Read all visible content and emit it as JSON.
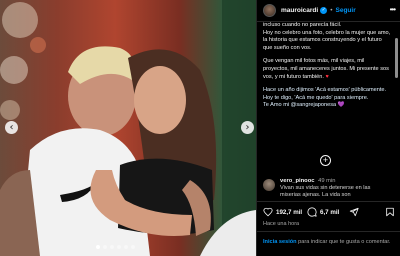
{
  "post": {
    "username": "mauroicardi",
    "follow_label": "Seguir",
    "more_icon": "more-icon",
    "separator": "•",
    "caption": [
      "incluso cuando no parecía fácil.\nHoy no celebro una foto, celebro la mujer que amo, la historia que estamos construyendo y el futuro que sueño con vos.",
      "Que vengan mil fotos más, mil viajes, mil proyectos, mil amaneceres juntos. Mi presente sos vos, y mi futuro también.",
      "Hace un año dijimos 'Acá estamos' públicamente.\nHoy te digo, 'Acá me quedo' para siempre.\nTe Amo mi @sangrejaponesa"
    ],
    "caption_emoji_1": "♥",
    "caption_emoji_2": "💜",
    "add_comment_icon": "+",
    "comment": {
      "user": "vero_pinooc",
      "time": "49 min",
      "text": "Vivan sus vidas sin detenerse en las miserias ajenas. La vida son"
    },
    "likes": "192,7 mil",
    "comments": "6,7 mil",
    "timestamp": "Hace una hora",
    "login_link": "Inicia sesión",
    "login_text": " para indicar que te gusta o comentar."
  },
  "media": {
    "prev_icon": "‹",
    "next_icon": "›",
    "slide_count": 6,
    "active_slide": 1
  },
  "colors": {
    "accent": "#0095f6",
    "background": "#000000",
    "heart": "#ff3040"
  }
}
